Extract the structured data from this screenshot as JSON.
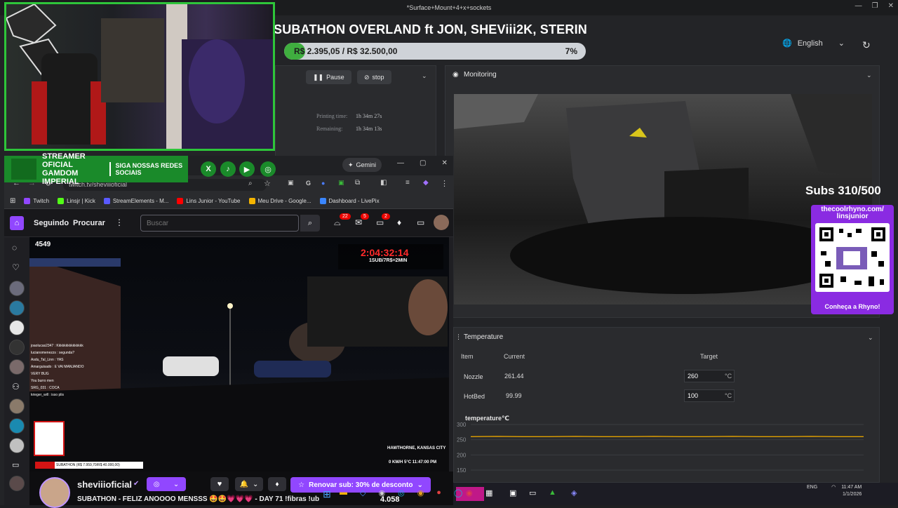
{
  "printer": {
    "window_title": "*Surface+Mount+4+x+sockets",
    "subathon_title": "SUBATHON OVERLAND ft JON, SHEViii2K, STERIN",
    "goal_text": "R$ 2.395,05 / R$ 32.500,00",
    "goal_percent_label": "7%",
    "goal_fraction": 0.07,
    "language": "English",
    "pause_label": "Pause",
    "stop_label": "stop",
    "printing_time_label": "Printing time:",
    "printing_time_value": "1h 34m 27s",
    "remaining_label": "Remaining:",
    "remaining_value": "1h 34m 13s",
    "monitoring_title": "Monitoring",
    "temperature_title": "Temperature",
    "table_headers": {
      "item": "Item",
      "current": "Current",
      "target": "Target"
    },
    "rows": [
      {
        "item": "Nozzle",
        "current": "261.44",
        "target": "260",
        "unit": "°C"
      },
      {
        "item": "HotBed",
        "current": "99.99",
        "target": "100",
        "unit": "°C"
      }
    ],
    "chart_title": "temperature℃"
  },
  "chart_data": {
    "type": "line",
    "title": "temperature℃",
    "y_ticks": [
      300,
      250,
      200,
      150
    ],
    "ylim": [
      120,
      300
    ],
    "series": [
      {
        "values": [
          260,
          261,
          260,
          260,
          261,
          260,
          260,
          261,
          260,
          260,
          261,
          260,
          260,
          261,
          260,
          260
        ],
        "color": "#e0a000"
      }
    ]
  },
  "overlay": {
    "banner_left": "STREAMER OFICIAL GAMDOM IMPERIAL",
    "banner_right": "SIGA NOSSAS REDES SOCIAIS",
    "subs_counter": "Subs 310/500",
    "qr_url": "thecoolrhyno.com/ linsjunior",
    "qr_cta": "Conheça a Rhyno!",
    "socials": [
      "X",
      "TikTok",
      "YouTube",
      "Instagram"
    ]
  },
  "browser": {
    "gemini_label": "Gemini",
    "url": "twitch.tv/sheviiioficial",
    "bookmarks": [
      {
        "label": "Twitch",
        "color": "#9147ff"
      },
      {
        "label": "Linsjr | Kick",
        "color": "#53fc18"
      },
      {
        "label": "StreamElements - M...",
        "color": "#5a5aff"
      },
      {
        "label": "Lins Junior - YouTube",
        "color": "#ff0000"
      },
      {
        "label": "Meu Drive - Google...",
        "color": "#f4b400"
      },
      {
        "label": "Dashboard - LivePix",
        "color": "#3a86ff"
      }
    ]
  },
  "twitch": {
    "seguindo": "Seguindo",
    "procurar": "Procurar",
    "search_placeholder": "Buscar",
    "badges": [
      "22",
      "5",
      "2"
    ],
    "viewers": "4549",
    "timer": "2:04:32:14",
    "timer_sub": "1SUB/7R$=2MIN",
    "location": "HAWTHORNE, KANSAS CITY",
    "speed": "0 KM/H  5°C  11:47:00 PM",
    "chat_lines": [
      "joaolucas2347 : Kkkkkkkkkkkkkkk",
      "lucianomenezzs : segunda?",
      "Asdu_Tal_Linn : YAS",
      "Amarguisado : E VAI MANJANDO",
      "VERY BUG",
      "You burro men",
      "SRG_031 : COCA",
      "krieger_will : isso plis"
    ],
    "mini_goal": "SUBATHON (R$ 7.959,70/R$ 40.000,00)",
    "channel_name": "sheviiioficial",
    "stream_title": "SUBATHON - FELIZ ANOOOO MENSSS 🤩🤩💗💗💗 - DAY 71 !fibras !ub",
    "resub_label": "Renovar sub: 30% de desconto",
    "overlay_counter": "4.058"
  },
  "taskbar": {
    "time": "11:47 AM",
    "date": "1/1/2026",
    "lang": "ENG"
  }
}
